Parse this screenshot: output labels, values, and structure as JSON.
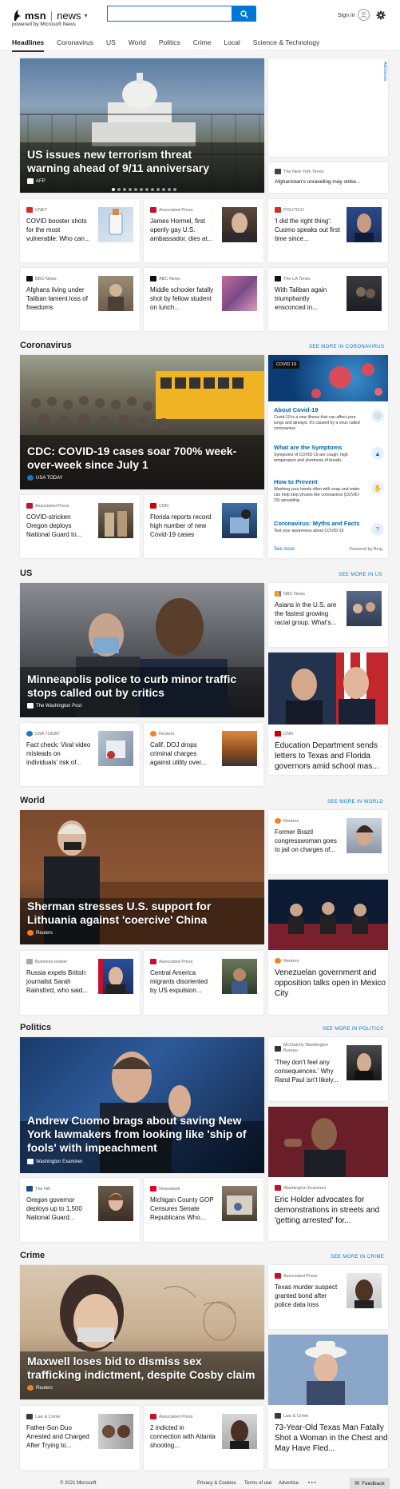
{
  "header": {
    "logo_brand": "msn",
    "logo_section": "news",
    "powered_by": "powered by Microsoft News",
    "search_value": "",
    "signin": "Sign in"
  },
  "nav": [
    "Headlines",
    "Coronavirus",
    "US",
    "World",
    "Politics",
    "Crime",
    "Local",
    "Science & Technology"
  ],
  "ad_label": "AdChoices",
  "top": {
    "hero_title": "US issues new terrorism threat warning ahead of 9/11 anniversary",
    "hero_source": "AFP",
    "side_source": "The New York Times",
    "side_headline": "Afghanistan's unraveling may strike...",
    "cards": [
      {
        "source": "CNET",
        "headline": "COVID booster shots for the most vulnerable: Who can..."
      },
      {
        "source": "Associated Press",
        "headline": "James Hormel, first openly gay U.S. ambassador, dies at..."
      },
      {
        "source": "POLITICO",
        "headline": "'I did the right thing': Cuomo speaks out first time since..."
      },
      {
        "source": "BBC News",
        "headline": "Afghans living under Taliban lament loss of freedoms"
      },
      {
        "source": "ABC News",
        "headline": "Middle schooler fatally shot by fellow student on lunch..."
      },
      {
        "source": "The LA Times",
        "headline": "With Taliban again triumphantly ensconced in..."
      }
    ]
  },
  "coronavirus": {
    "title": "Coronavirus",
    "see_more": "SEE MORE IN CORONAVIRUS",
    "hero_title": "CDC: COVID-19 cases soar 700% week-over-week since July 1",
    "hero_source": "USA TODAY",
    "cards": [
      {
        "source": "Associated Press",
        "headline": "COVID-stricken Oregon deploys National Guard to..."
      },
      {
        "source": "CNN",
        "headline": "Florida reports record high number of new Covid-19 cases"
      }
    ],
    "panel_tag": "COVID 19",
    "panel_items": [
      {
        "title": "About Covid-19",
        "desc": "Covid-19 is a new illness that can affect your lungs and airways. It's caused by a virus called coronavirus."
      },
      {
        "title": "What are the Symptoms",
        "desc": "Symptoms of COVID-19 are cough, high temperature and shortness of breath."
      },
      {
        "title": "How to Prevent",
        "desc": "Washing your hands often with soap and water can help stop viruses like coronavirus (COVID-19) spreading."
      },
      {
        "title": "Coronavirus: Myths and Facts",
        "desc": "Test your awareness about COVID-19"
      }
    ],
    "panel_see_more": "See more",
    "panel_powered": "Powered by Bing"
  },
  "us": {
    "title": "US",
    "see_more": "SEE MORE IN US",
    "hero_title": "Minneapolis police to curb minor traffic stops called out by critics",
    "hero_source": "The Washington Post",
    "side": {
      "source": "NBC News",
      "headline": "Asians in the U.S. are the fastest growing racial group. What's..."
    },
    "cards": [
      {
        "source": "USA TODAY",
        "headline": "Fact check: Viral video misleads on individuals' risk of..."
      },
      {
        "source": "Reuters",
        "headline": "Calif. DOJ drops criminal charges against utility over..."
      }
    ],
    "big": {
      "source": "CNN",
      "headline": "Education Department sends letters to Texas and Florida governors amid school mas..."
    }
  },
  "world": {
    "title": "World",
    "see_more": "SEE MORE IN WORLD",
    "hero_title": "Sherman stresses U.S. support for Lithuania against 'coercive' China",
    "hero_source": "Reuters",
    "side": {
      "source": "Reuters",
      "headline": "Former Brazil congresswoman goes to jail on charges of..."
    },
    "cards": [
      {
        "source": "Business Insider",
        "headline": "Russia expels British journalist Sarah Rainsford, who said..."
      },
      {
        "source": "Associated Press",
        "headline": "Central America migrants disoriented by US expulsion..."
      }
    ],
    "big": {
      "source": "Reuters",
      "headline": "Venezuelan government and opposition talks open in Mexico City"
    }
  },
  "politics": {
    "title": "Politics",
    "see_more": "SEE MORE IN POLITICS",
    "hero_title": "Andrew Cuomo brags about saving New York lawmakers from looking like 'ship of fools' with impeachment",
    "hero_source": "Washington Examiner",
    "side": {
      "source": "McClatchy Washington Bureau",
      "headline": "'They don't feel any consequences.' Why Rand Paul isn't likely..."
    },
    "cards": [
      {
        "source": "The Hill",
        "headline": "Oregon governor deploys up to 1,500 National Guard..."
      },
      {
        "source": "Newsweek",
        "headline": "Michigan County GOP Censures Senate Republicans Who..."
      }
    ],
    "big": {
      "source": "Washington Examiner",
      "headline": "Eric Holder advocates for demonstrations in streets and 'getting arrested' for..."
    }
  },
  "crime": {
    "title": "Crime",
    "see_more": "SEE MORE IN CRIME",
    "hero_title": "Maxwell loses bid to dismiss sex trafficking indictment, despite Cosby claim",
    "hero_source": "Reuters",
    "side": {
      "source": "Associated Press",
      "headline": "Texas murder suspect granted bond after police data loss"
    },
    "cards": [
      {
        "source": "Law & Crime",
        "headline": "Father-Son Duo Arrested and Charged After Trying to..."
      },
      {
        "source": "Associated Press",
        "headline": "2 indicted in connection with Atlanta shooting..."
      }
    ],
    "big": {
      "source": "Law & Crime",
      "headline": "73-Year-Old Texas Man Fatally Shot a Woman in the Chest and May Have Fled..."
    }
  },
  "footer": {
    "copyright": "© 2021 Microsoft",
    "links": [
      "Privacy & Cookies",
      "Terms of use",
      "Advertise"
    ],
    "more": "• • •",
    "feedback": "Feedback"
  }
}
